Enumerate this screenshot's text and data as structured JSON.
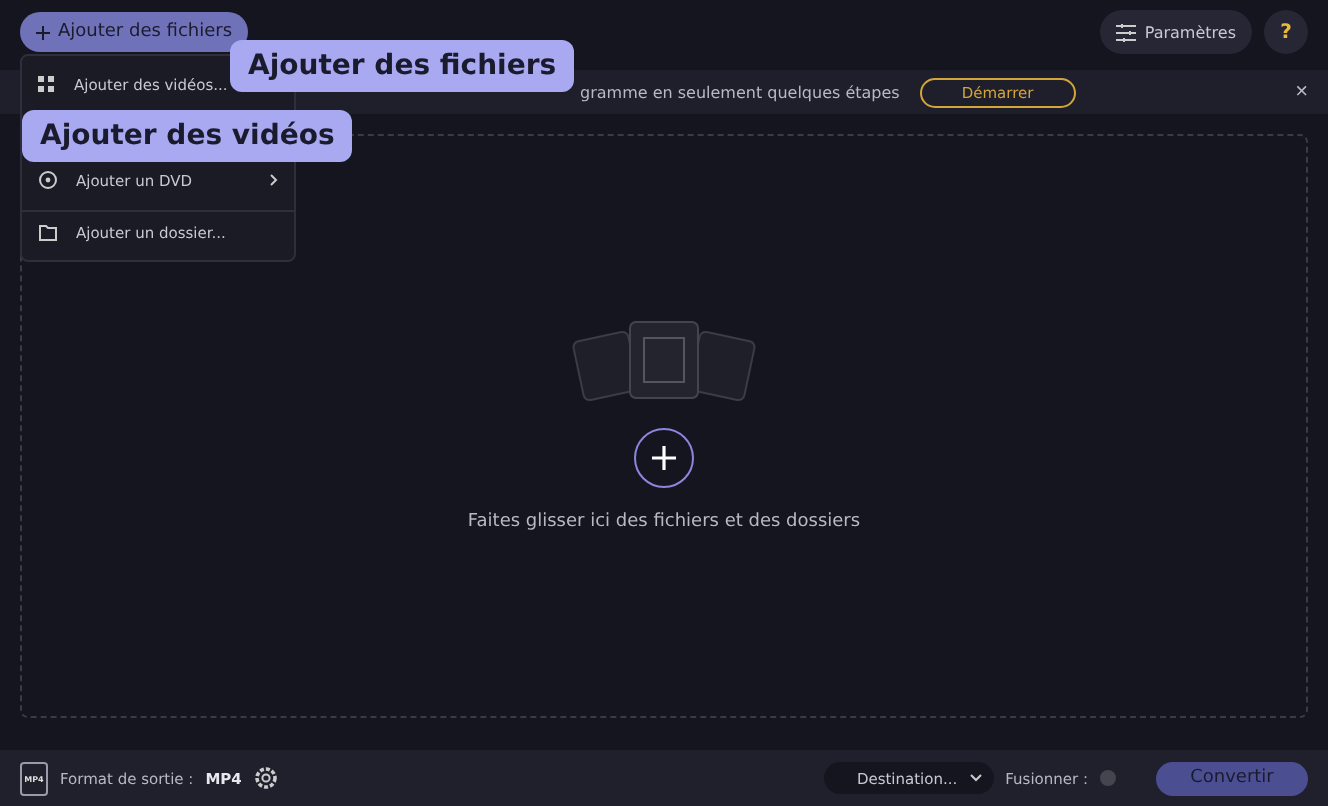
{
  "toolbar": {
    "add_button": "Ajouter des fichiers",
    "settings_button": "Paramètres",
    "help_button": "?"
  },
  "banner": {
    "text": "gramme en seulement quelques étapes",
    "start_button": "Démarrer",
    "close": "×"
  },
  "add_menu": {
    "items": [
      {
        "label": "Ajouter des vidéos...",
        "kind": "video",
        "divider_before": false
      },
      {
        "label": "Ajouter un DVD",
        "kind": "dvd",
        "has_submenu": true,
        "divider_before": false
      },
      {
        "label": "Ajouter un dossier...",
        "kind": "folder",
        "has_submenu": false,
        "divider_before": true
      }
    ]
  },
  "callouts": [
    {
      "text": "Ajouter des fichiers",
      "kind": "right"
    },
    {
      "text": "Ajouter des vidéos",
      "kind": "below"
    }
  ],
  "drop_zone": {
    "text": "Faites glisser ici des fichiers et des dossiers"
  },
  "bottom_bar": {
    "format_label": "Format de sortie :",
    "format_value": "MP4",
    "format_icon_text": "MP4",
    "destination": "Destination...",
    "merge_label": "Fusionner :",
    "merge_on": false,
    "convert_button": "Convertir"
  }
}
